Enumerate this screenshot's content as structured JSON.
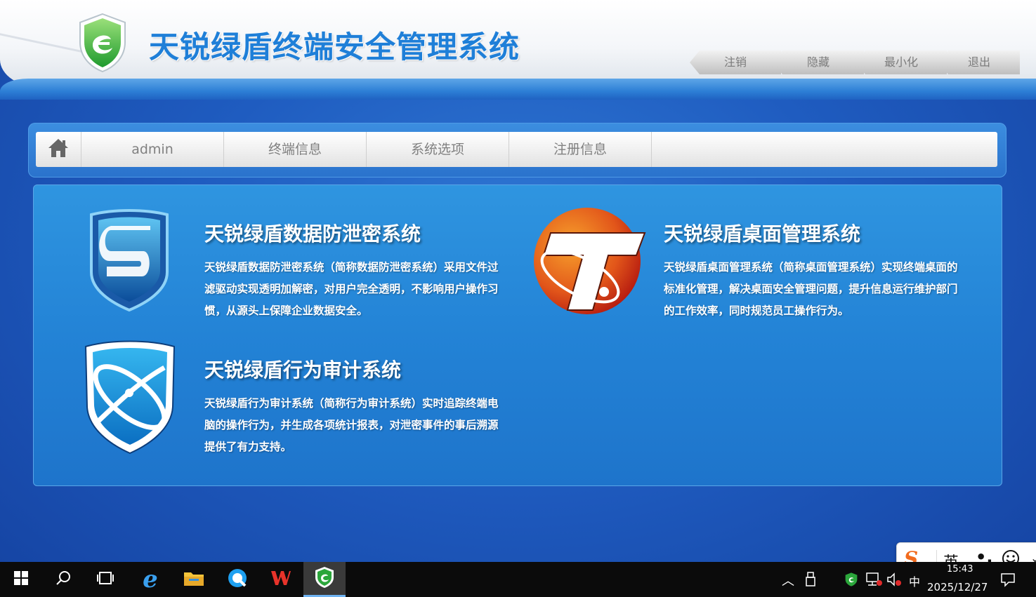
{
  "app": {
    "title": "天锐绿盾终端安全管理系统"
  },
  "window_buttons": [
    {
      "label": "注销"
    },
    {
      "label": "隐藏"
    },
    {
      "label": "最小化"
    },
    {
      "label": "退出"
    }
  ],
  "nav": {
    "items": [
      {
        "label": "admin"
      },
      {
        "label": "终端信息"
      },
      {
        "label": "系统选项"
      },
      {
        "label": "注册信息"
      }
    ]
  },
  "products": [
    {
      "title": "天锐绿盾数据防泄密系统",
      "description": "天锐绿盾数据防泄密系统（简称数据防泄密系统）采用文件过滤驱动实现透明加解密，对用户完全透明，不影响用户操作习惯，从源头上保障企业数据安全。",
      "icon": "shield-s-icon"
    },
    {
      "title": "天锐绿盾桌面管理系统",
      "description": "天锐绿盾桌面管理系统（简称桌面管理系统）实现终端桌面的标准化管理，解决桌面安全管理问题，提升信息运行维护部门的工作效率，同时规范员工操作行为。",
      "icon": "orange-t-icon"
    },
    {
      "title": "天锐绿盾行为审计系统",
      "description": "天锐绿盾行为审计系统（简称行为审计系统）实时追踪终端电脑的操作行为，并生成各项统计报表，对泄密事件的事后溯源提供了有力支持。",
      "icon": "shield-orbit-icon"
    }
  ],
  "taskbar": {
    "clock_time": "15:43",
    "clock_date": "2025/12/27",
    "ime_lang": "中",
    "ime_bar_mode": "英"
  },
  "colors": {
    "title_blue": "#1f7fd8",
    "panel_blue": "#2383d6",
    "background_blue": "#1f5cc0"
  }
}
